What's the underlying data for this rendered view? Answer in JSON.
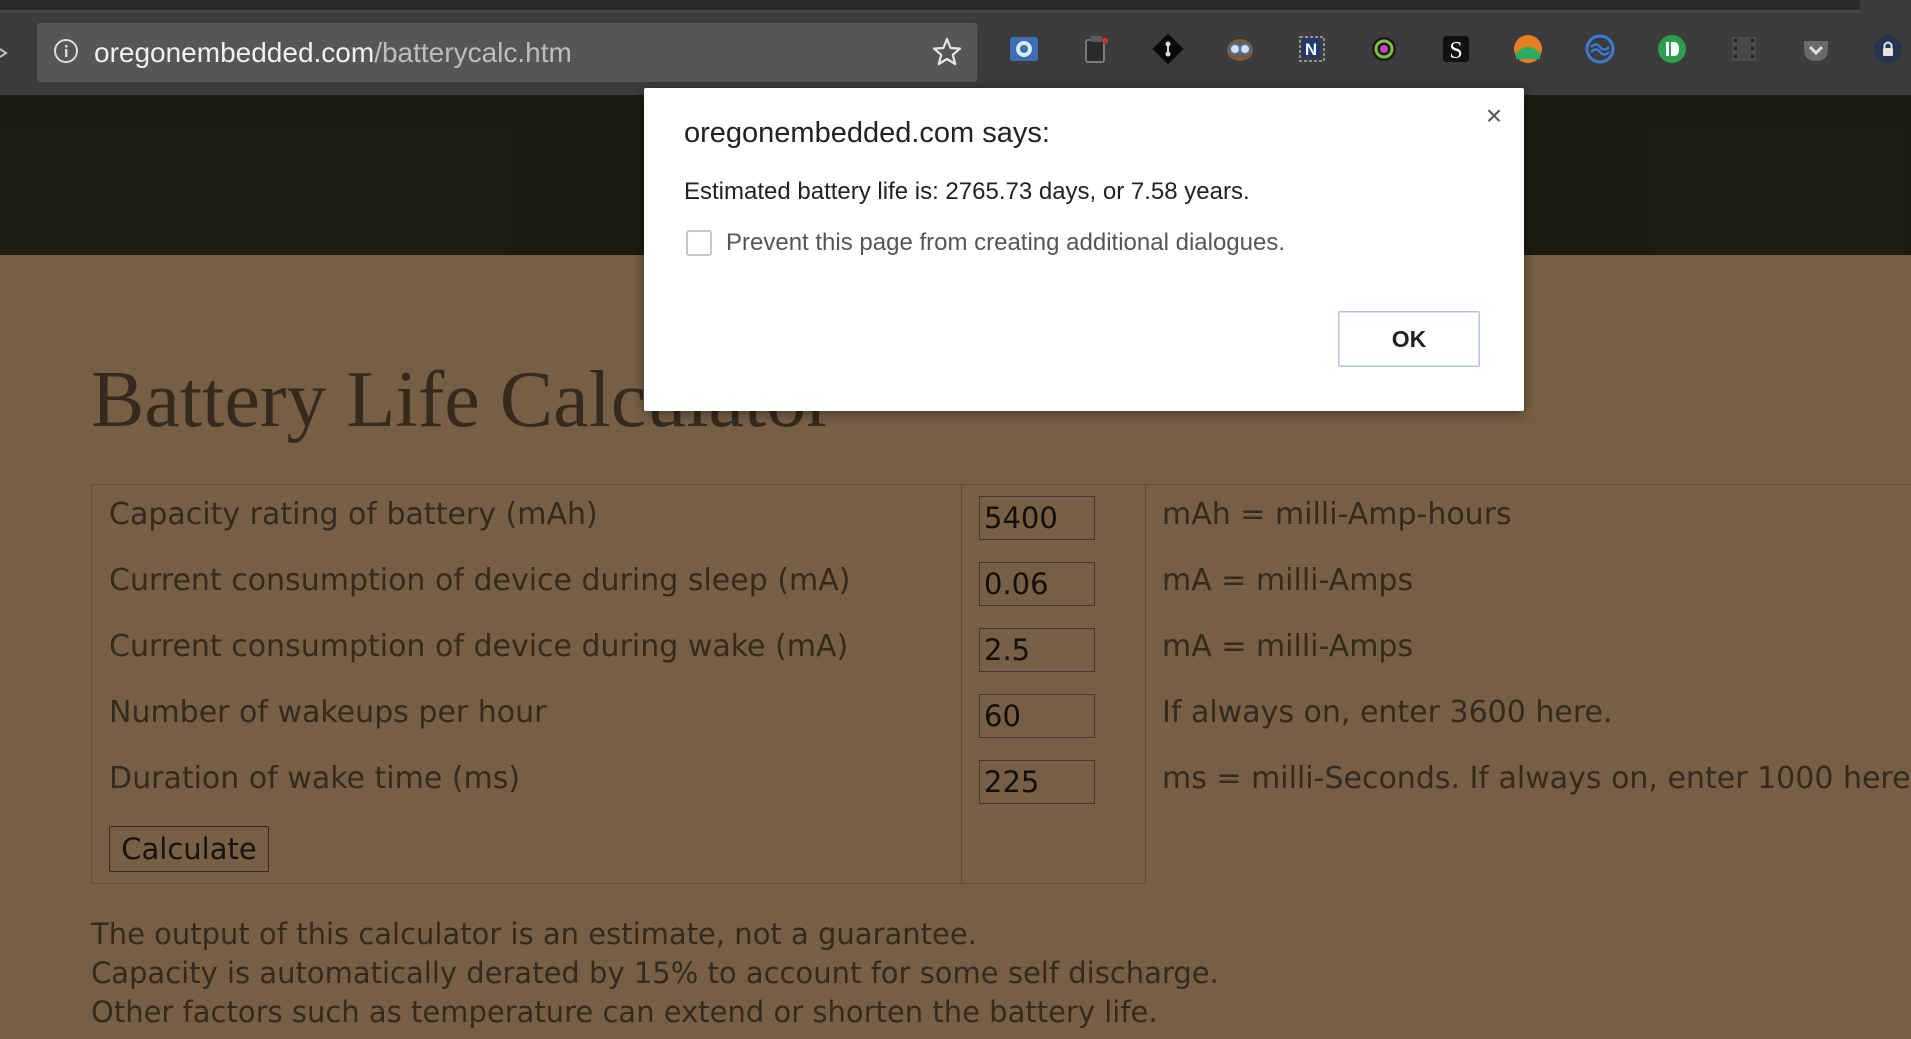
{
  "browser": {
    "url_domain": "oregonembedded.com",
    "url_path": "/batterycalc.htm",
    "extension_icons": [
      "screencast-icon",
      "clipboard-icon",
      "git-icon",
      "owl-icon",
      "onenote-clipper-icon",
      "color-picker-icon",
      "stylish-icon",
      "rocket-icon",
      "sync-icon",
      "pushbullet-icon",
      "film-icon",
      "pocket-icon",
      "lastpass-icon"
    ]
  },
  "page": {
    "title": "Battery Life Calculator",
    "rows": [
      {
        "label": "Capacity rating of battery (mAh)",
        "value": "5400",
        "note": "mAh = milli-Amp-hours"
      },
      {
        "label": "Current consumption of device during sleep (mA)",
        "value": "0.06",
        "note": "mA = milli-Amps"
      },
      {
        "label": "Current consumption of device during wake (mA)",
        "value": "2.5",
        "note": "mA = milli-Amps"
      },
      {
        "label": "Number of wakeups per hour",
        "value": "60",
        "note": "If always on, enter 3600 here."
      },
      {
        "label": "Duration of wake time (ms)",
        "value": "225",
        "note": "ms = milli-Seconds. If always on, enter 1000 here."
      }
    ],
    "calculate_label": "Calculate",
    "footnotes": [
      "The output of this calculator is an estimate, not a guarantee.",
      "Capacity is automatically derated by 15% to account for some self discharge.",
      "Other factors such as temperature can extend or shorten the battery life."
    ]
  },
  "dialog": {
    "title": "oregonembedded.com says:",
    "message": "Estimated battery life is: 2765.73 days, or 7.58 years.",
    "checkbox_label": "Prevent this page from creating additional dialogues.",
    "ok_label": "OK",
    "close_glyph": "×"
  }
}
